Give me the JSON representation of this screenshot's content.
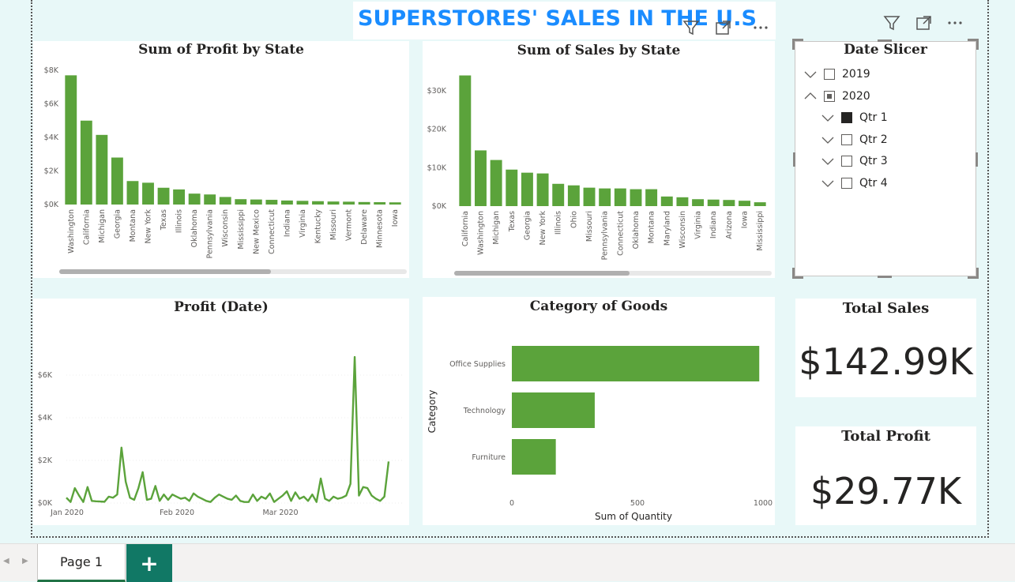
{
  "dashboard": {
    "title": "SUPERSTORES' SALES IN THE U.S",
    "accent_color": "#1a8cff",
    "bar_color": "#5ba33b"
  },
  "header_icons": [
    "filter-icon",
    "focus-mode-icon",
    "more-options-icon"
  ],
  "profit_by_state": {
    "title": "Sum of Profit by State",
    "chart_data": {
      "type": "bar",
      "categories": [
        "Washington",
        "California",
        "Michigan",
        "Georgia",
        "Montana",
        "New York",
        "Texas",
        "Illinois",
        "Oklahoma",
        "Pennsylvania",
        "Wisconsin",
        "Mississippi",
        "New Mexico",
        "Connecticut",
        "Indiana",
        "Virginia",
        "Kentucky",
        "Missouri",
        "Vermont",
        "Delaware",
        "Minnesota",
        "Iowa"
      ],
      "values": [
        7700,
        5000,
        4150,
        2800,
        1400,
        1300,
        1000,
        900,
        650,
        600,
        450,
        320,
        300,
        280,
        240,
        220,
        200,
        180,
        170,
        150,
        140,
        130
      ],
      "yticks": [
        "$0K",
        "$2K",
        "$4K",
        "$6K",
        "$8K"
      ],
      "ylim": [
        0,
        8000
      ]
    }
  },
  "sales_by_state": {
    "title": "Sum of Sales by State",
    "chart_data": {
      "type": "bar",
      "categories": [
        "California",
        "Washington",
        "Michigan",
        "Texas",
        "Georgia",
        "New York",
        "Illinois",
        "Ohio",
        "Missouri",
        "Pennsylvania",
        "Connecticut",
        "Oklahoma",
        "Montana",
        "Maryland",
        "Wisconsin",
        "Virginia",
        "Indiana",
        "Arizona",
        "Iowa",
        "Mississippi"
      ],
      "values": [
        34000,
        14500,
        12000,
        9500,
        8700,
        8500,
        5800,
        5400,
        4800,
        4600,
        4600,
        4400,
        4400,
        2500,
        2300,
        1800,
        1700,
        1600,
        1400,
        1000
      ],
      "yticks": [
        "$0K",
        "$10K",
        "$20K",
        "$30K"
      ],
      "ylim": [
        0,
        35000
      ]
    }
  },
  "date_slicer": {
    "title": "Date Slicer",
    "items": [
      {
        "label": "2019",
        "level": 0,
        "state": "unchecked",
        "expanded": false
      },
      {
        "label": "2020",
        "level": 0,
        "state": "partial",
        "expanded": true
      },
      {
        "label": "Qtr 1",
        "level": 1,
        "state": "checked",
        "expanded": false
      },
      {
        "label": "Qtr 2",
        "level": 1,
        "state": "unchecked",
        "expanded": false
      },
      {
        "label": "Qtr 3",
        "level": 1,
        "state": "unchecked",
        "expanded": false
      },
      {
        "label": "Qtr 4",
        "level": 1,
        "state": "unchecked",
        "expanded": false
      }
    ]
  },
  "profit_by_date": {
    "title": "Profit (Date)",
    "chart_data": {
      "type": "line",
      "x_labels": [
        "Jan 2020",
        "Feb 2020",
        "Mar 2020"
      ],
      "yticks": [
        "$0K",
        "$2K",
        "$4K",
        "$6K"
      ],
      "ylim": [
        0,
        7000
      ],
      "values": [
        250,
        50,
        700,
        350,
        50,
        750,
        100,
        80,
        70,
        60,
        300,
        250,
        400,
        2600,
        1000,
        250,
        150,
        700,
        1450,
        150,
        200,
        800,
        100,
        400,
        150,
        400,
        300,
        200,
        250,
        100,
        450,
        300,
        200,
        100,
        50,
        250,
        400,
        300,
        200,
        150,
        350,
        100,
        50,
        50,
        400,
        100,
        300,
        200,
        450,
        50,
        200,
        350,
        550,
        100,
        500,
        200,
        300,
        100,
        400,
        50,
        1150,
        200,
        100,
        300,
        200,
        250,
        350,
        900,
        6850,
        350,
        750,
        700,
        350,
        200,
        100,
        300,
        1950
      ]
    }
  },
  "category_of_goods": {
    "title": "Category of Goods",
    "chart_data": {
      "type": "bar",
      "orientation": "horizontal",
      "categories": [
        "Office Supplies",
        "Technology",
        "Furniture"
      ],
      "values": [
        985,
        330,
        175
      ],
      "xticks": [
        "0",
        "500",
        "1000"
      ],
      "xlim": [
        0,
        1000
      ],
      "xlabel": "Sum of Quantity",
      "ylabel": "Category"
    }
  },
  "total_sales": {
    "title": "Total Sales",
    "value": "$142.99K"
  },
  "total_profit": {
    "title": "Total Profit",
    "value": "$29.77K"
  },
  "tabs": {
    "page_label": "Page 1",
    "add_label": "+"
  }
}
